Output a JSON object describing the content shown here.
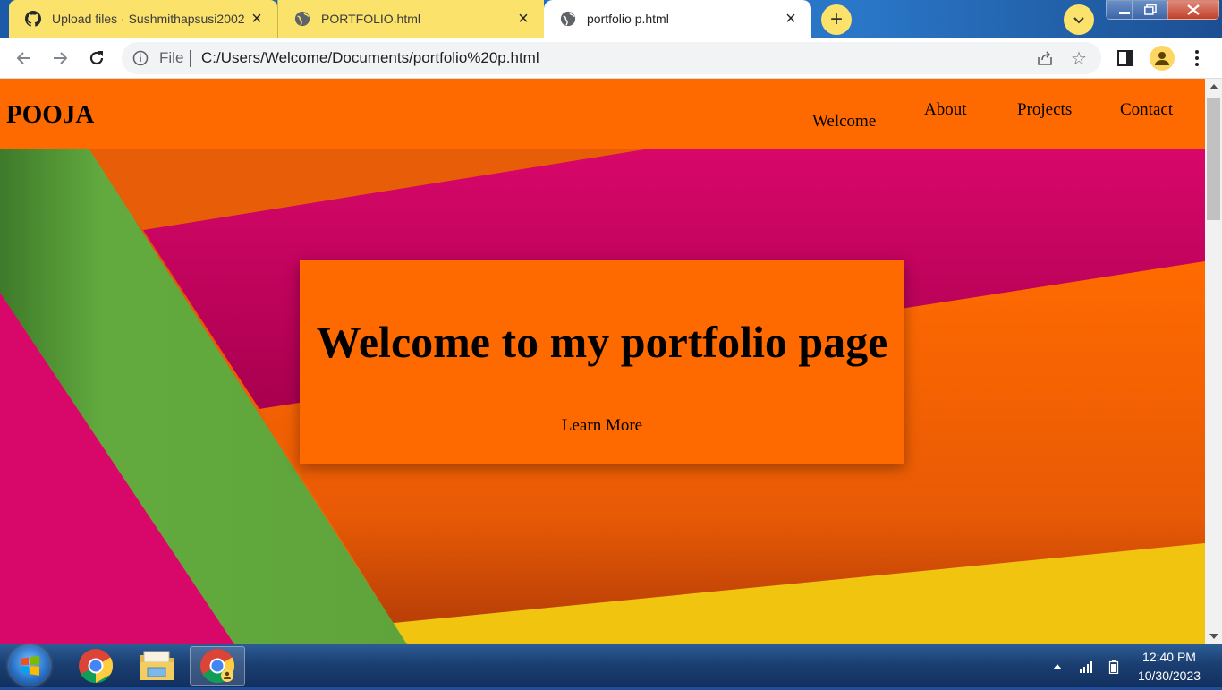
{
  "browser": {
    "tabs": [
      {
        "label": "Upload files · Sushmithapsusi2002",
        "icon": "github-icon",
        "active": false
      },
      {
        "label": "PORTFOLIO.html",
        "icon": "globe-icon",
        "active": false
      },
      {
        "label": "portfolio p.html",
        "icon": "globe-icon",
        "active": true
      }
    ],
    "new_tab_label": "+",
    "address": {
      "scheme_label": "File",
      "url": "C:/Users/Welcome/Documents/portfolio%20p.html"
    }
  },
  "site": {
    "brand": "POOJA",
    "nav": [
      "Welcome",
      "About",
      "Projects",
      "Contact"
    ],
    "hero": {
      "title": "Welcome to my portfolio page",
      "button": "Learn More"
    }
  },
  "taskbar": {
    "apps": [
      "chrome-icon",
      "file-explorer-icon",
      "chrome-icon"
    ],
    "clock": {
      "time": "12:40 PM",
      "date": "10/30/2023"
    }
  },
  "colors": {
    "nav_bg": "#ff6a00",
    "hero_card": "#ff6a00",
    "tab_inactive": "#fbe26b",
    "magenta": "#d8076a",
    "green": "#62aa3e",
    "yellow": "#f1c40f"
  }
}
